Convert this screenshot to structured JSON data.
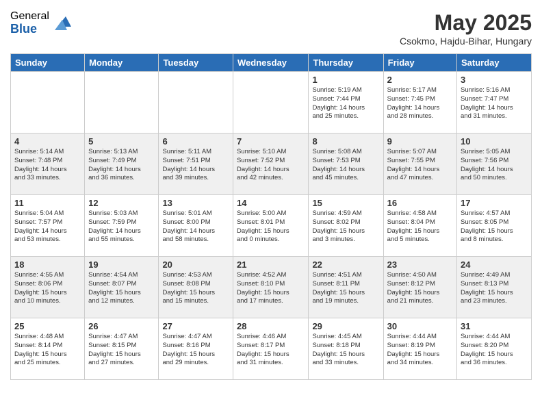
{
  "header": {
    "logo_general": "General",
    "logo_blue": "Blue",
    "month_title": "May 2025",
    "location": "Csokmo, Hajdu-Bihar, Hungary"
  },
  "weekdays": [
    "Sunday",
    "Monday",
    "Tuesday",
    "Wednesday",
    "Thursday",
    "Friday",
    "Saturday"
  ],
  "weeks": [
    [
      {
        "day": "",
        "info": ""
      },
      {
        "day": "",
        "info": ""
      },
      {
        "day": "",
        "info": ""
      },
      {
        "day": "",
        "info": ""
      },
      {
        "day": "1",
        "info": "Sunrise: 5:19 AM\nSunset: 7:44 PM\nDaylight: 14 hours\nand 25 minutes."
      },
      {
        "day": "2",
        "info": "Sunrise: 5:17 AM\nSunset: 7:45 PM\nDaylight: 14 hours\nand 28 minutes."
      },
      {
        "day": "3",
        "info": "Sunrise: 5:16 AM\nSunset: 7:47 PM\nDaylight: 14 hours\nand 31 minutes."
      }
    ],
    [
      {
        "day": "4",
        "info": "Sunrise: 5:14 AM\nSunset: 7:48 PM\nDaylight: 14 hours\nand 33 minutes."
      },
      {
        "day": "5",
        "info": "Sunrise: 5:13 AM\nSunset: 7:49 PM\nDaylight: 14 hours\nand 36 minutes."
      },
      {
        "day": "6",
        "info": "Sunrise: 5:11 AM\nSunset: 7:51 PM\nDaylight: 14 hours\nand 39 minutes."
      },
      {
        "day": "7",
        "info": "Sunrise: 5:10 AM\nSunset: 7:52 PM\nDaylight: 14 hours\nand 42 minutes."
      },
      {
        "day": "8",
        "info": "Sunrise: 5:08 AM\nSunset: 7:53 PM\nDaylight: 14 hours\nand 45 minutes."
      },
      {
        "day": "9",
        "info": "Sunrise: 5:07 AM\nSunset: 7:55 PM\nDaylight: 14 hours\nand 47 minutes."
      },
      {
        "day": "10",
        "info": "Sunrise: 5:05 AM\nSunset: 7:56 PM\nDaylight: 14 hours\nand 50 minutes."
      }
    ],
    [
      {
        "day": "11",
        "info": "Sunrise: 5:04 AM\nSunset: 7:57 PM\nDaylight: 14 hours\nand 53 minutes."
      },
      {
        "day": "12",
        "info": "Sunrise: 5:03 AM\nSunset: 7:59 PM\nDaylight: 14 hours\nand 55 minutes."
      },
      {
        "day": "13",
        "info": "Sunrise: 5:01 AM\nSunset: 8:00 PM\nDaylight: 14 hours\nand 58 minutes."
      },
      {
        "day": "14",
        "info": "Sunrise: 5:00 AM\nSunset: 8:01 PM\nDaylight: 15 hours\nand 0 minutes."
      },
      {
        "day": "15",
        "info": "Sunrise: 4:59 AM\nSunset: 8:02 PM\nDaylight: 15 hours\nand 3 minutes."
      },
      {
        "day": "16",
        "info": "Sunrise: 4:58 AM\nSunset: 8:04 PM\nDaylight: 15 hours\nand 5 minutes."
      },
      {
        "day": "17",
        "info": "Sunrise: 4:57 AM\nSunset: 8:05 PM\nDaylight: 15 hours\nand 8 minutes."
      }
    ],
    [
      {
        "day": "18",
        "info": "Sunrise: 4:55 AM\nSunset: 8:06 PM\nDaylight: 15 hours\nand 10 minutes."
      },
      {
        "day": "19",
        "info": "Sunrise: 4:54 AM\nSunset: 8:07 PM\nDaylight: 15 hours\nand 12 minutes."
      },
      {
        "day": "20",
        "info": "Sunrise: 4:53 AM\nSunset: 8:08 PM\nDaylight: 15 hours\nand 15 minutes."
      },
      {
        "day": "21",
        "info": "Sunrise: 4:52 AM\nSunset: 8:10 PM\nDaylight: 15 hours\nand 17 minutes."
      },
      {
        "day": "22",
        "info": "Sunrise: 4:51 AM\nSunset: 8:11 PM\nDaylight: 15 hours\nand 19 minutes."
      },
      {
        "day": "23",
        "info": "Sunrise: 4:50 AM\nSunset: 8:12 PM\nDaylight: 15 hours\nand 21 minutes."
      },
      {
        "day": "24",
        "info": "Sunrise: 4:49 AM\nSunset: 8:13 PM\nDaylight: 15 hours\nand 23 minutes."
      }
    ],
    [
      {
        "day": "25",
        "info": "Sunrise: 4:48 AM\nSunset: 8:14 PM\nDaylight: 15 hours\nand 25 minutes."
      },
      {
        "day": "26",
        "info": "Sunrise: 4:47 AM\nSunset: 8:15 PM\nDaylight: 15 hours\nand 27 minutes."
      },
      {
        "day": "27",
        "info": "Sunrise: 4:47 AM\nSunset: 8:16 PM\nDaylight: 15 hours\nand 29 minutes."
      },
      {
        "day": "28",
        "info": "Sunrise: 4:46 AM\nSunset: 8:17 PM\nDaylight: 15 hours\nand 31 minutes."
      },
      {
        "day": "29",
        "info": "Sunrise: 4:45 AM\nSunset: 8:18 PM\nDaylight: 15 hours\nand 33 minutes."
      },
      {
        "day": "30",
        "info": "Sunrise: 4:44 AM\nSunset: 8:19 PM\nDaylight: 15 hours\nand 34 minutes."
      },
      {
        "day": "31",
        "info": "Sunrise: 4:44 AM\nSunset: 8:20 PM\nDaylight: 15 hours\nand 36 minutes."
      }
    ]
  ]
}
